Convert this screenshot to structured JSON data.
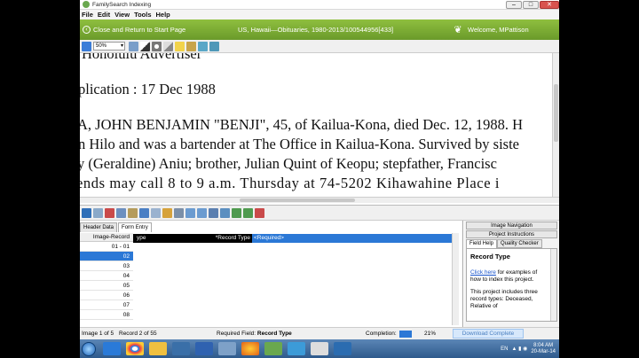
{
  "window": {
    "title": "FamilySearch Indexing",
    "minimize": "–",
    "maximize": "□",
    "close": "✕"
  },
  "menu": [
    "File",
    "Edit",
    "View",
    "Tools",
    "Help"
  ],
  "nav": {
    "back_label": "Close and Return to Start Page",
    "batch_title": "US, Hawaii—Obituaries, 1980-2013/100544956[433]",
    "welcome": "Welcome, MPattison"
  },
  "image_toolbar": {
    "zoom": "50%"
  },
  "document_lines": [
    "Honolulu Advertiser",
    "plication : 17 Dec 1988",
    "A, JOHN BENJAMIN \"BENJI\", 45, of Kailua-Kona, died Dec. 12, 1988. H",
    "n Hilo and was a bartender at The Office in Kailua-Kona. Survived by siste",
    "y (Geraldine) Aniu; brother, Julian Quint of Keopu; stepfather, Francisc",
    "ends may call 8 to 9 a.m. Thursday at 74-5202 Kihawahine Place i"
  ],
  "form": {
    "tabs": [
      "Header Data",
      "Form Entry"
    ],
    "record_header": "Image-Record",
    "records": [
      "01 - 01",
      "02",
      "03",
      "04",
      "05",
      "06",
      "07",
      "08"
    ],
    "selected_record_index": 1,
    "field_prefix": "ype",
    "field_label": "*Record Type",
    "field_value": "<Required>"
  },
  "help": {
    "image_navigation": "Image Navigation",
    "project_instructions": "Project Instructions",
    "tab_field_help": "Field Help",
    "tab_quality_checker": "Quality Checker",
    "heading": "Record Type",
    "link_text": "Click here",
    "link_rest": " for examples of how to index this project.",
    "para2": "This project includes three record types: Deceased, Relative of"
  },
  "status": {
    "image": "Image 1 of 5",
    "record": "Record 2 of 55",
    "required_label": "Required Field: ",
    "required_field": "Record Type",
    "completion_label": "Completion:",
    "completion_value": "21%",
    "completion_fraction": 0.21,
    "download_button": "Download Complete"
  },
  "taskbar": {
    "lang": "EN",
    "time": "8:04 AM",
    "date": "20-Mar-14"
  },
  "colors": {
    "nav_green": "#7aad35",
    "selection_blue": "#2b78d6"
  }
}
